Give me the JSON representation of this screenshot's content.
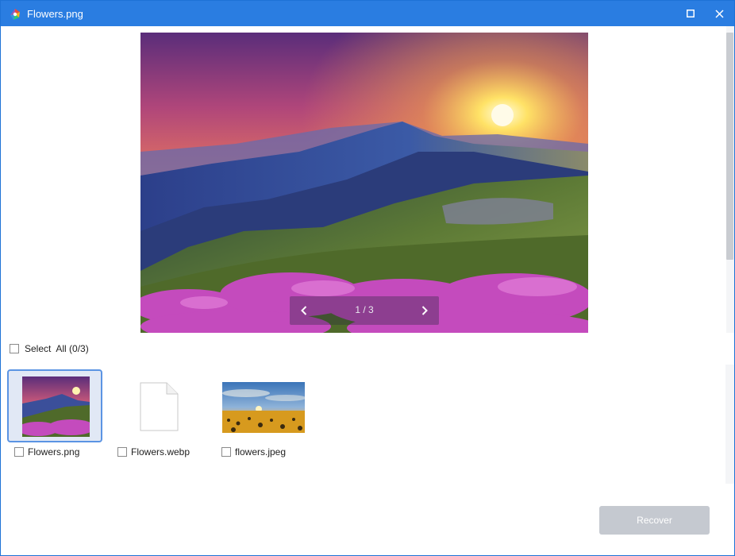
{
  "window": {
    "title": "Flowers.png",
    "app_icon": "colorful-app-icon",
    "controls": [
      "maximize-icon",
      "close-icon"
    ],
    "accent_color": "#2a7de1"
  },
  "preview": {
    "image": "mountain-sunset-flowers",
    "pager_label": "1 / 3",
    "prev_icon": "chevron-left-icon",
    "next_icon": "chevron-right-icon"
  },
  "select_all": {
    "label": "Select  All (0/3)",
    "checked": false
  },
  "files": [
    {
      "name": "Flowers.png",
      "thumbnail": "mountain-sunset-flowers",
      "checked": false,
      "selected": true
    },
    {
      "name": "Flowers.webp",
      "thumbnail": "generic-file-icon",
      "checked": false,
      "selected": false
    },
    {
      "name": "flowers.jpeg",
      "thumbnail": "sunflower-field",
      "checked": false,
      "selected": false
    }
  ],
  "actions": {
    "recover_label": "Recover",
    "recover_color": "#c5c9d0"
  }
}
